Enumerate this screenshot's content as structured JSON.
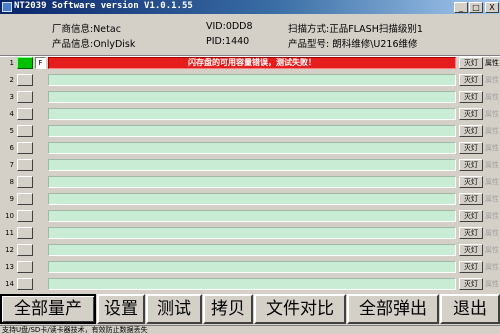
{
  "window": {
    "title": "NT2039 Software version V1.0.1.55",
    "minimize": "_",
    "maximize": "□",
    "close": "X"
  },
  "info": {
    "vendor": "厂商信息:Netac",
    "product": "产品信息:OnlyDisk",
    "vid": "VID:0DD8",
    "pid": "PID:1440",
    "scan_mode": "扫描方式:正品FLASH扫描级别1",
    "model": "产品型号: 朗科维修\\U216维修"
  },
  "ports": [
    {
      "num": "1",
      "led_on": true,
      "flag": "F",
      "message": "闪存盘的可用容量错误，测试失败！",
      "status": "fail",
      "button": "灭灯",
      "attr": "属性",
      "attr_active": true
    },
    {
      "num": "2",
      "led_on": false,
      "message": "",
      "status": "idle",
      "button": "灭灯",
      "attr": "属性",
      "attr_active": false
    },
    {
      "num": "3",
      "led_on": false,
      "message": "",
      "status": "idle",
      "button": "灭灯",
      "attr": "属性",
      "attr_active": false
    },
    {
      "num": "4",
      "led_on": false,
      "message": "",
      "status": "idle",
      "button": "灭灯",
      "attr": "属性",
      "attr_active": false
    },
    {
      "num": "5",
      "led_on": false,
      "message": "",
      "status": "idle",
      "button": "灭灯",
      "attr": "属性",
      "attr_active": false
    },
    {
      "num": "6",
      "led_on": false,
      "message": "",
      "status": "idle",
      "button": "灭灯",
      "attr": "属性",
      "attr_active": false
    },
    {
      "num": "7",
      "led_on": false,
      "message": "",
      "status": "idle",
      "button": "灭灯",
      "attr": "属性",
      "attr_active": false
    },
    {
      "num": "8",
      "led_on": false,
      "message": "",
      "status": "idle",
      "button": "灭灯",
      "attr": "属性",
      "attr_active": false
    },
    {
      "num": "9",
      "led_on": false,
      "message": "",
      "status": "idle",
      "button": "灭灯",
      "attr": "属性",
      "attr_active": false
    },
    {
      "num": "10",
      "led_on": false,
      "message": "",
      "status": "idle",
      "button": "灭灯",
      "attr": "属性",
      "attr_active": false
    },
    {
      "num": "11",
      "led_on": false,
      "message": "",
      "status": "idle",
      "button": "灭灯",
      "attr": "属性",
      "attr_active": false
    },
    {
      "num": "12",
      "led_on": false,
      "message": "",
      "status": "idle",
      "button": "灭灯",
      "attr": "属性",
      "attr_active": false
    },
    {
      "num": "13",
      "led_on": false,
      "message": "",
      "status": "idle",
      "button": "灭灯",
      "attr": "属性",
      "attr_active": false
    },
    {
      "num": "14",
      "led_on": false,
      "message": "",
      "status": "idle",
      "button": "灭灯",
      "attr": "属性",
      "attr_active": false
    }
  ],
  "toolbar": {
    "mass_production": "全部量产",
    "settings": "设置",
    "test": "测试",
    "copy": "拷贝",
    "file_compare": "文件对比",
    "eject_all": "全部弹出",
    "exit": "退出"
  },
  "status_bar": "支持U盘/SD卡/读卡器技术，有效防止数据丢失",
  "colors": {
    "fail_bar": "#e51d1d",
    "idle_bar": "#c8ecd4",
    "led_on": "#00c000",
    "title_bar": "#0a246a"
  }
}
